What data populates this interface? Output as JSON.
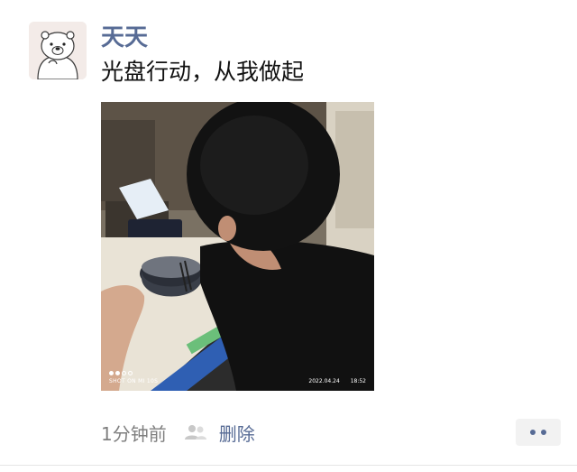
{
  "post": {
    "author": "天天",
    "text": "光盘行动，从我做起",
    "avatar_icon": "polar-bear-avatar",
    "photo": {
      "description_icon": "person-eating-from-bowl-photo",
      "watermark_left": "SHOT ON MI 10S",
      "date": "2022.04.24",
      "time": "18:52"
    },
    "meta": {
      "time_ago": "1分钟前",
      "visibility_icon": "friends-icon",
      "delete_label": "删除"
    },
    "more_icon": "more-dots-icon"
  },
  "colors": {
    "link": "#576b95",
    "text": "#111111",
    "muted": "#7f7f7f",
    "more_bg": "#f2f2f2"
  }
}
